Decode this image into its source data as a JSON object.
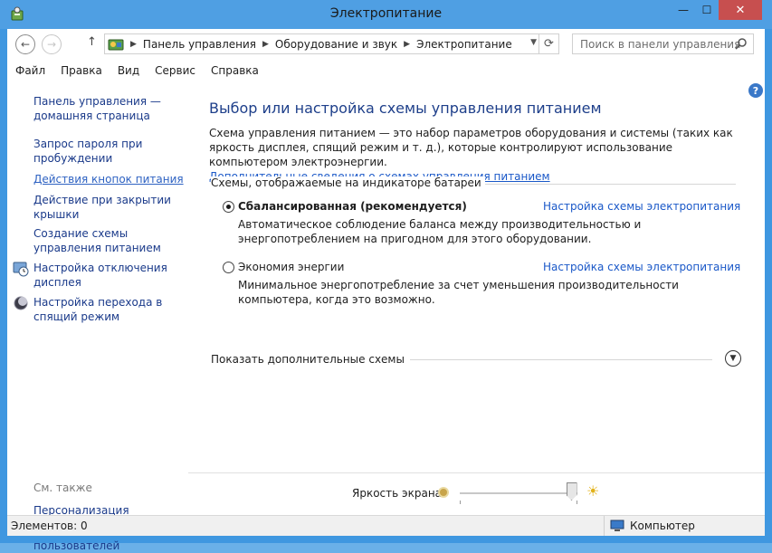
{
  "window": {
    "title": "Электропитание",
    "minimize": "—",
    "maximize": "☐",
    "close": "✕"
  },
  "address": {
    "back": "←",
    "forward": "→",
    "up": "↑",
    "crumbs": [
      "Панель управления",
      "Оборудование и звук",
      "Электропитание"
    ],
    "refresh": "⟳",
    "search_placeholder": "Поиск в панели управления"
  },
  "menu": [
    "Файл",
    "Правка",
    "Вид",
    "Сервис",
    "Справка"
  ],
  "help": "?",
  "sidebar": {
    "items": [
      "Панель управления — домашняя страница",
      "Запрос пароля при пробуждении",
      "Действия кнопок питания",
      "Действие при закрытии крышки",
      "Создание схемы управления питанием",
      "Настройка отключения дисплея",
      "Настройка перехода в спящий режим"
    ],
    "see_also": "См. также",
    "see_also_items": [
      "Персонализация",
      "Учетные записи пользователей"
    ]
  },
  "main": {
    "heading": "Выбор или настройка схемы управления питанием",
    "description": "Схема управления питанием — это набор параметров оборудования и системы (таких как яркость дисплея, спящий режим и т. д.), которые контролируют использование компьютером электроэнергии.",
    "more_link": "Дополнительные сведения о схемах управления питанием",
    "group_label": "Схемы, отображаемые на индикаторе батареи",
    "plans": [
      {
        "name": "Сбалансированная (рекомендуется)",
        "selected": true,
        "link": "Настройка схемы электропитания",
        "description": "Автоматическое соблюдение баланса между производительностью и энергопотреблением на пригодном для этого оборудовании."
      },
      {
        "name": "Экономия энергии",
        "selected": false,
        "link": "Настройка схемы электропитания",
        "description": "Минимальное энергопотребление за счет уменьшения производительности компьютера, когда это возможно."
      }
    ],
    "show_more": "Показать дополнительные схемы"
  },
  "brightness": {
    "label": "Яркость экрана:",
    "level_percent": 95
  },
  "status": {
    "items": "Элементов: 0",
    "location": "Компьютер"
  },
  "colors": {
    "titlebar": "#4f9fe3",
    "link": "#1a58c8",
    "heading": "#1e3f8a"
  }
}
